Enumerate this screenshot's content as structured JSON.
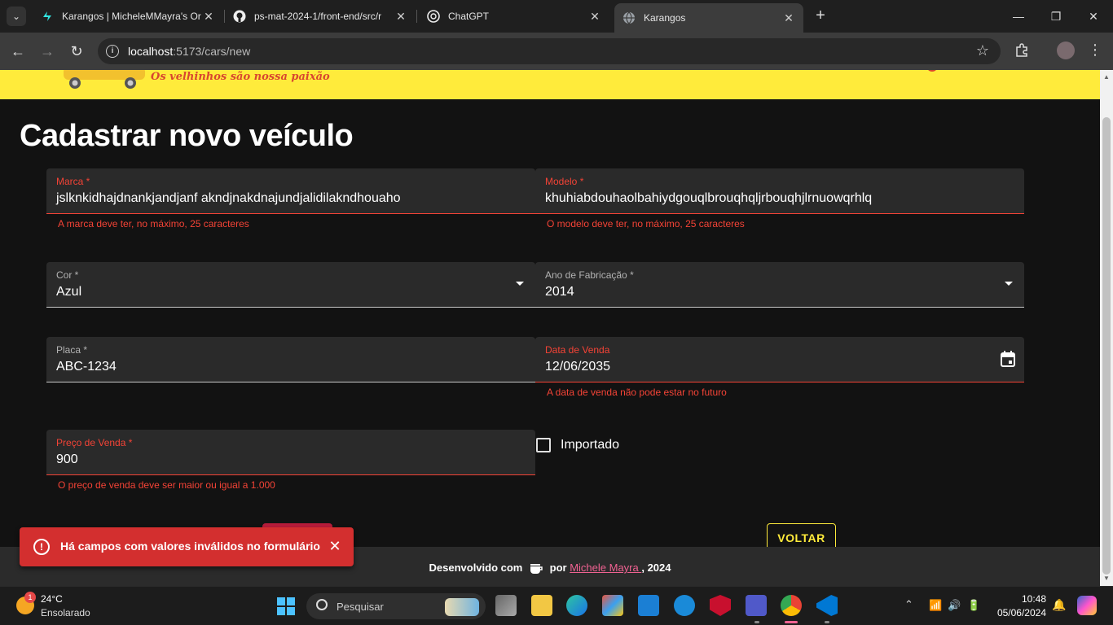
{
  "browser": {
    "tabs": [
      {
        "title": "Karangos | MicheleMMayra's Or",
        "icon": "netlify-icon"
      },
      {
        "title": "ps-mat-2024-1/front-end/src/r",
        "icon": "github-icon"
      },
      {
        "title": "ChatGPT",
        "icon": "chatgpt-icon"
      },
      {
        "title": "Karangos",
        "icon": "globe-icon",
        "active": true
      }
    ],
    "url_host": "localhost",
    "url_rest": ":5173/cars/new"
  },
  "header": {
    "slogan": "Os velhinhos são nossa paixão",
    "colors": {
      "background": "#ffeb3b",
      "accent": "#d8462f"
    }
  },
  "page": {
    "title": "Cadastrar novo veículo"
  },
  "form": {
    "brand": {
      "label": "Marca *",
      "value": "jslknkidhajdnankjandjanf akndjnakdnajundjalidilakndhouaho",
      "error": "A marca deve ter, no máximo, 25 caracteres"
    },
    "model": {
      "label": "Modelo *",
      "value": "khuhiabdouhaolbahiydgouqlbrouqhqljrbouqhjlrnuowqrhlq",
      "error": "O modelo deve ter, no máximo, 25 caracteres"
    },
    "color": {
      "label": "Cor *",
      "value": "Azul"
    },
    "year": {
      "label": "Ano de Fabricação *",
      "value": "2014"
    },
    "plate": {
      "label": "Placa *",
      "value": "ABC-1234"
    },
    "sale_date": {
      "label": "Data de Venda",
      "value": "12/06/2035",
      "error": "A data de venda não pode estar no futuro"
    },
    "price": {
      "label": "Preço de Venda *",
      "value": "900",
      "error": "O preço de venda deve ser maior ou igual a 1.000"
    },
    "imported": {
      "label": "Importado",
      "checked": false
    },
    "back_button": "VOLTAR"
  },
  "snackbar": {
    "message": "Há campos com valores inválidos no formulário",
    "color": "#d32f2f"
  },
  "footer": {
    "prefix": "Desenvolvido com",
    "by": "por",
    "author": "Michele Mayra ",
    "suffix": ", 2024"
  },
  "taskbar": {
    "weather_temp": "24°C",
    "weather_desc": "Ensolarado",
    "weather_badge": "1",
    "search_placeholder": "Pesquisar",
    "time": "10:48",
    "date": "05/06/2024"
  }
}
